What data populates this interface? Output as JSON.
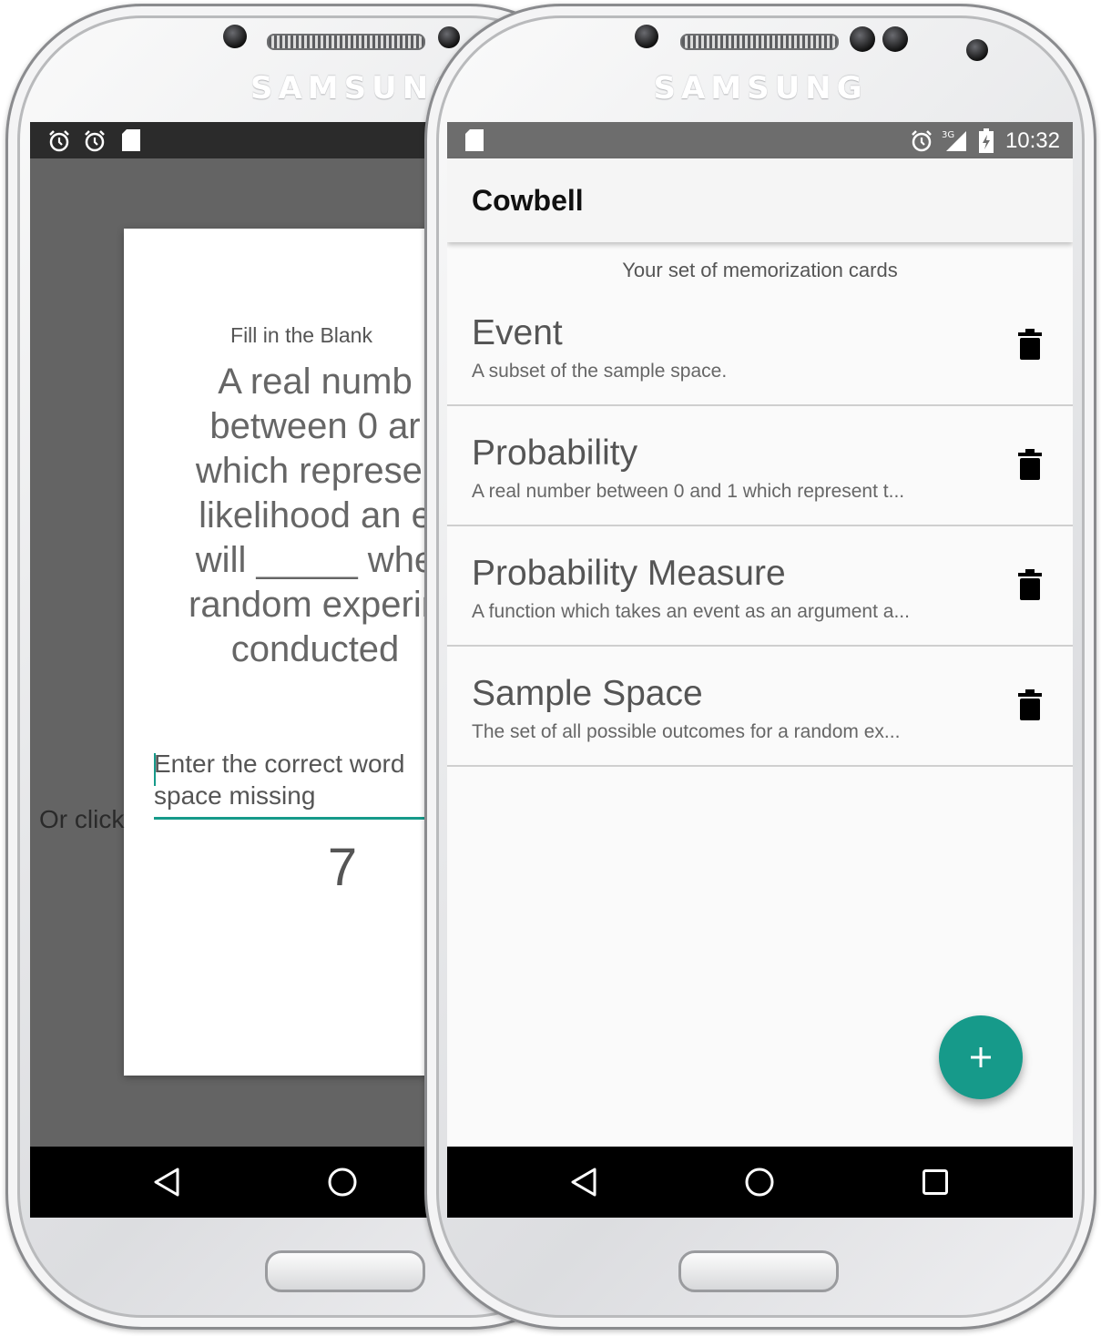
{
  "device": {
    "brand": "SAMSUNG"
  },
  "quiz_screen": {
    "quiz_type": "Fill in the Blank",
    "question_lines": "A real numb\nbetween 0 ar\nwhich represer\nlikelihood an e\nwill _____ whe\nrandom experin\nconducted",
    "answer_placeholder_line1": "Enter the correct word",
    "answer_placeholder_line2": "space missing",
    "countdown": "7",
    "or_click": "Or click"
  },
  "list_screen": {
    "status_time": "10:32",
    "app_title": "Cowbell",
    "subtitle": "Your set of memorization cards",
    "cards": [
      {
        "term": "Event",
        "definition": "A subset of the sample space."
      },
      {
        "term": "Probability",
        "definition": "A real number between 0 and 1 which represent t..."
      },
      {
        "term": "Probability Measure",
        "definition": "A function which takes an event as an argument a..."
      },
      {
        "term": "Sample Space",
        "definition": "The set of all possible outcomes for a random ex..."
      }
    ],
    "fab_icon": "plus-icon"
  },
  "colors": {
    "accent": "#169a8a",
    "statusbar": "#6d6d6d",
    "navbar": "#000000"
  }
}
